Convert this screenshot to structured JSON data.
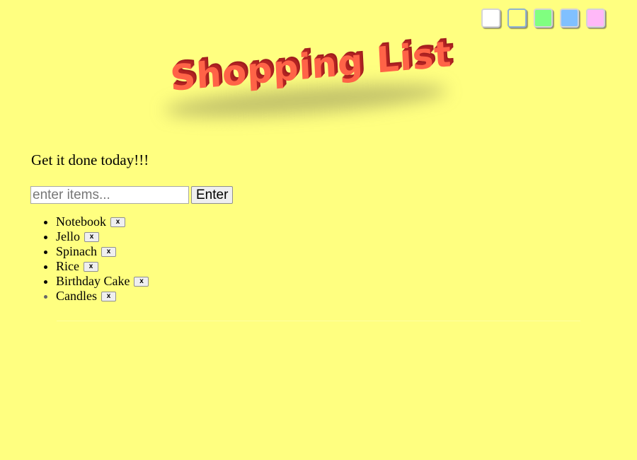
{
  "theme": {
    "background": "#ffff80",
    "swatches": [
      {
        "name": "white",
        "color": "#ffffff",
        "active": false
      },
      {
        "name": "yellow",
        "color": "#ffff80",
        "active": true
      },
      {
        "name": "green",
        "color": "#80ff80",
        "active": false
      },
      {
        "name": "blue",
        "color": "#80c0ff",
        "active": false
      },
      {
        "name": "pink",
        "color": "#ffb8f8",
        "active": false
      }
    ]
  },
  "header": {
    "title": "Shopping List"
  },
  "tagline": "Get it done today!!!",
  "entry": {
    "placeholder": "enter items...",
    "value": "",
    "button_label": "Enter"
  },
  "list": {
    "delete_label": "x",
    "items": [
      "Notebook",
      "Jello",
      "Spinach",
      "Rice",
      "Birthday Cake",
      "Candles"
    ]
  }
}
